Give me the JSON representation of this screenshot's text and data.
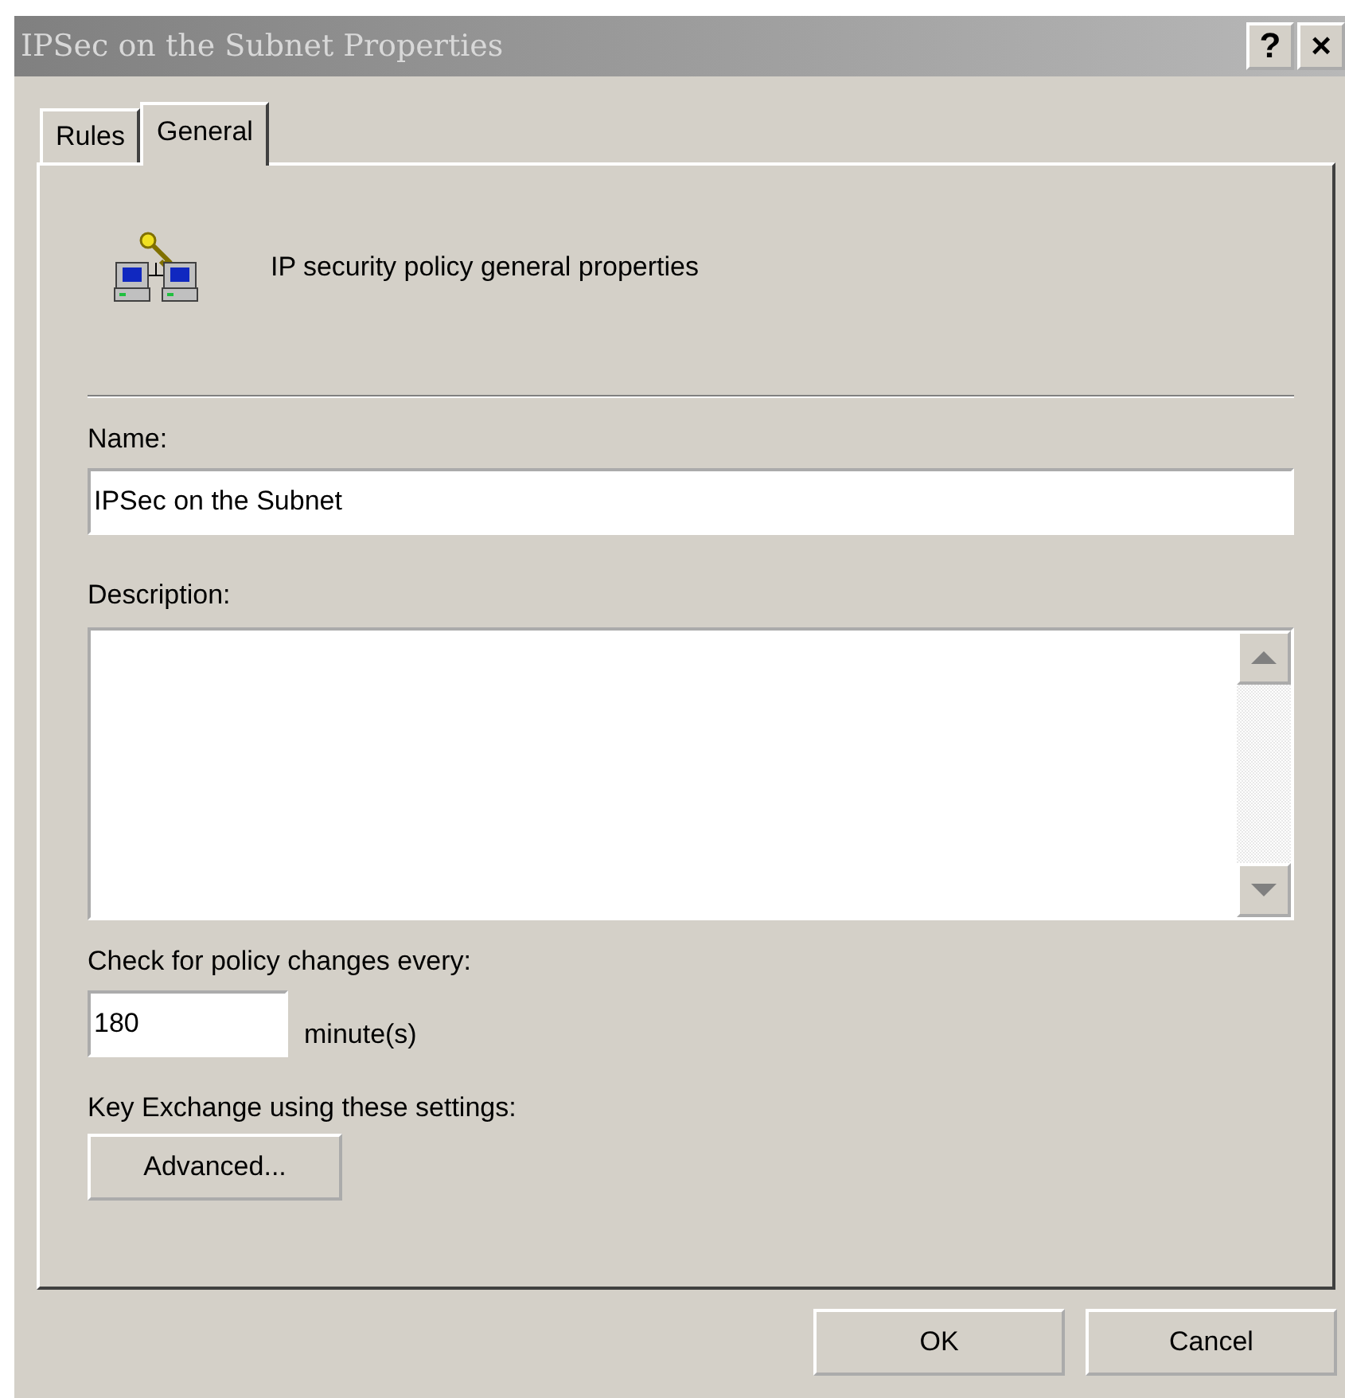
{
  "window": {
    "title": "IPSec on the Subnet Properties",
    "title_buttons": [
      "?",
      "×"
    ]
  },
  "tabs": [
    {
      "label": "Rules",
      "selected": false
    },
    {
      "label": "General",
      "selected": true
    }
  ],
  "header": {
    "text": "IP security policy general properties"
  },
  "name": {
    "label": "Name:",
    "value": "IPSec on the Subnet"
  },
  "description": {
    "label": "Description:"
  },
  "interval": {
    "label": "Check for policy changes every:",
    "value": "180",
    "unit": "minute(s)"
  },
  "key_exchange": {
    "label": "Key Exchange using these settings:",
    "button": "Advanced..."
  },
  "buttons": [
    "OK",
    "Cancel"
  ]
}
